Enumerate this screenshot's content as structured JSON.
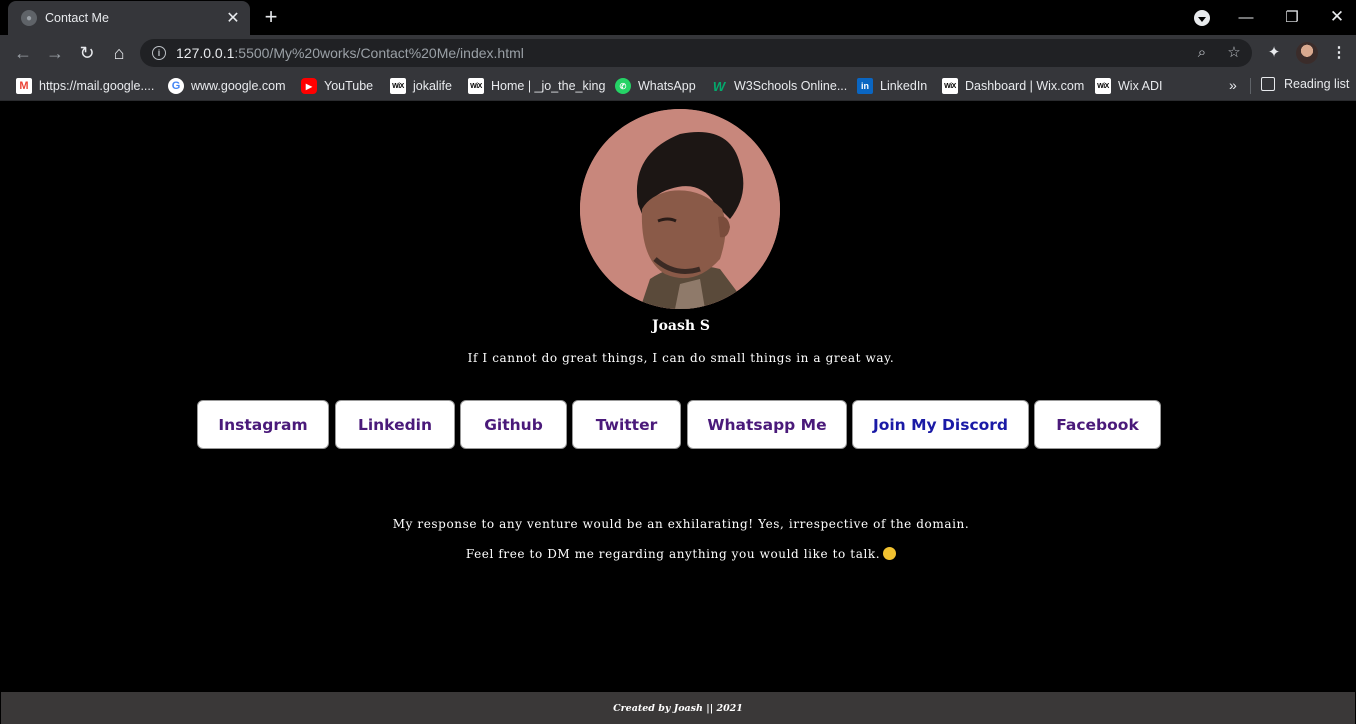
{
  "browser": {
    "tab": {
      "title": "Contact Me"
    },
    "url": {
      "host": "127.0.0.1",
      "path": ":5500/My%20works/Contact%20Me/index.html"
    },
    "bookmarks": [
      {
        "label": "https://mail.google....",
        "icon": "gmail-icon"
      },
      {
        "label": "www.google.com",
        "icon": "google-icon"
      },
      {
        "label": "YouTube",
        "icon": "youtube-icon"
      },
      {
        "label": "jokalife",
        "icon": "wix-icon"
      },
      {
        "label": "Home | _jo_the_king",
        "icon": "wix-icon"
      },
      {
        "label": "WhatsApp",
        "icon": "whatsapp-icon"
      },
      {
        "label": "W3Schools Online...",
        "icon": "w3schools-icon"
      },
      {
        "label": "LinkedIn",
        "icon": "linkedin-icon"
      },
      {
        "label": "Dashboard | Wix.com",
        "icon": "wix-icon"
      },
      {
        "label": "Wix ADI",
        "icon": "wix-icon"
      }
    ],
    "reading_list": "Reading list"
  },
  "profile": {
    "name": "Joash S",
    "quote": "If I cannot do great things, I can do small things in a great way."
  },
  "buttons": [
    {
      "label": "Instagram"
    },
    {
      "label": "Linkedin"
    },
    {
      "label": "Github"
    },
    {
      "label": "Twitter"
    },
    {
      "label": "Whatsapp Me"
    },
    {
      "label": "Join My Discord"
    },
    {
      "label": "Facebook"
    }
  ],
  "blurb": {
    "line1": "My response to any venture would be an exhilarating! Yes, irrespective of the domain.",
    "line2": "Feel free to DM me regarding anything you would like to talk."
  },
  "footer": {
    "text": "Created by Joash || 2021"
  },
  "colors": {
    "page_bg": "#000000",
    "footer_bg": "#3a3838",
    "button_text": "#4a1a7a",
    "discord_text": "#1a1aa6"
  }
}
